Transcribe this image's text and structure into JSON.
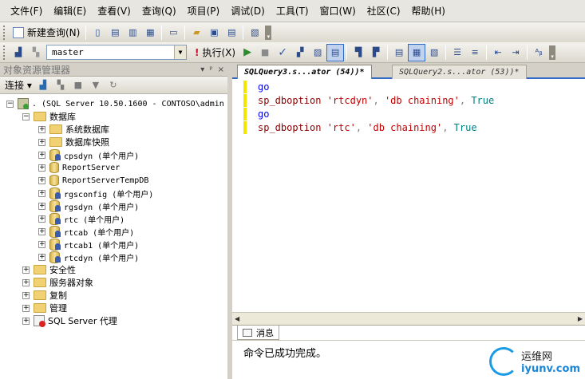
{
  "menubar": {
    "items": [
      "文件(F)",
      "编辑(E)",
      "查看(V)",
      "查询(Q)",
      "项目(P)",
      "调试(D)",
      "工具(T)",
      "窗口(W)",
      "社区(C)",
      "帮助(H)"
    ]
  },
  "toolbar1": {
    "new_query_label": "新建查询(N)"
  },
  "toolbar2": {
    "database": "master",
    "execute_label": "执行(X)"
  },
  "object_explorer": {
    "title": "对象资源管理器",
    "controls": [
      "▾",
      "ᵖ",
      "×"
    ],
    "connect_label": "连接",
    "tree": [
      {
        "label": ". (SQL Server 10.50.1600 - CONTOSO\\admin",
        "indent": 0,
        "kind": "server",
        "expander": "−"
      },
      {
        "label": "数据库",
        "indent": 1,
        "kind": "folder",
        "expander": "−"
      },
      {
        "label": "系统数据库",
        "indent": 2,
        "kind": "folder",
        "expander": "+"
      },
      {
        "label": "数据库快照",
        "indent": 2,
        "kind": "folder",
        "expander": "+"
      },
      {
        "label": "cpsdyn (单个用户)",
        "indent": 2,
        "kind": "dbuser",
        "expander": "+"
      },
      {
        "label": "ReportServer",
        "indent": 2,
        "kind": "db",
        "expander": "+"
      },
      {
        "label": "ReportServerTempDB",
        "indent": 2,
        "kind": "db",
        "expander": "+"
      },
      {
        "label": "rgsconfig (单个用户)",
        "indent": 2,
        "kind": "dbuser",
        "expander": "+"
      },
      {
        "label": "rgsdyn (单个用户)",
        "indent": 2,
        "kind": "dbuser",
        "expander": "+"
      },
      {
        "label": "rtc (单个用户)",
        "indent": 2,
        "kind": "dbuser",
        "expander": "+"
      },
      {
        "label": "rtcab (单个用户)",
        "indent": 2,
        "kind": "dbuser",
        "expander": "+"
      },
      {
        "label": "rtcab1 (单个用户)",
        "indent": 2,
        "kind": "dbuser",
        "expander": "+"
      },
      {
        "label": "rtcdyn (单个用户)",
        "indent": 2,
        "kind": "dbuser",
        "expander": "+"
      },
      {
        "label": "安全性",
        "indent": 1,
        "kind": "folder",
        "expander": "+"
      },
      {
        "label": "服务器对象",
        "indent": 1,
        "kind": "folder",
        "expander": "+"
      },
      {
        "label": "复制",
        "indent": 1,
        "kind": "folder",
        "expander": "+"
      },
      {
        "label": "管理",
        "indent": 1,
        "kind": "folder",
        "expander": "+"
      },
      {
        "label": "SQL Server 代理",
        "indent": 1,
        "kind": "agent",
        "expander": "+"
      }
    ]
  },
  "editor": {
    "tabs": [
      "SQLQuery3.s...ator (54))*",
      "SQLQuery2.s...ator (53))*"
    ],
    "lines": [
      [
        {
          "t": "go",
          "c": "kw"
        }
      ],
      [
        {
          "t": "sp_dboption ",
          "c": "fn"
        },
        {
          "t": "'rtcdyn'",
          "c": "str"
        },
        {
          "t": ", ",
          "c": "pl"
        },
        {
          "t": "'db chaining'",
          "c": "str"
        },
        {
          "t": ", ",
          "c": "pl"
        },
        {
          "t": "True",
          "c": "cst"
        }
      ],
      [
        {
          "t": "go",
          "c": "kw"
        }
      ],
      [
        {
          "t": "sp_dboption ",
          "c": "fn"
        },
        {
          "t": "'rtc'",
          "c": "str"
        },
        {
          "t": ", ",
          "c": "pl"
        },
        {
          "t": "'db chaining'",
          "c": "str"
        },
        {
          "t": ", ",
          "c": "pl"
        },
        {
          "t": "True",
          "c": "cst"
        }
      ]
    ]
  },
  "messages": {
    "tab_label": "消息",
    "text": "命令已成功完成。"
  },
  "watermark": {
    "name": "运维网",
    "url": "iyunv.com"
  }
}
